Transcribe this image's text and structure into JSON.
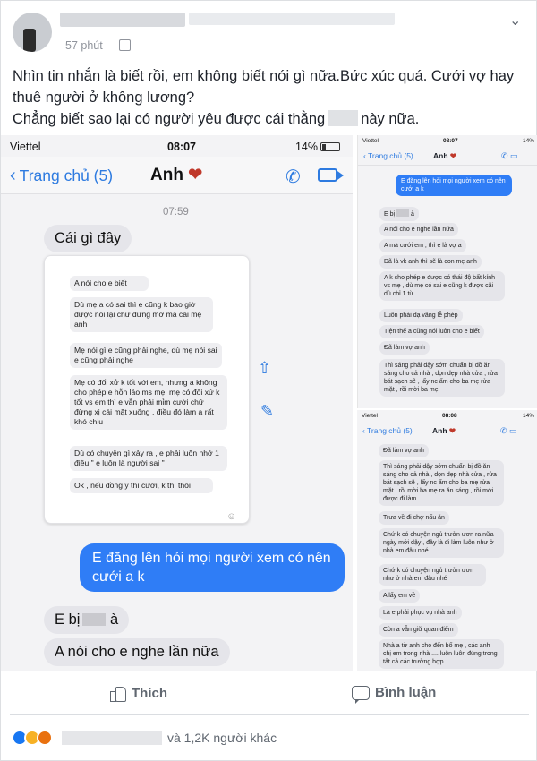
{
  "post": {
    "time": "57 phút",
    "caption_line1": "Nhìn tin nhắn là biết rồi, em không biết nói gì nữa.Bức xúc quá. Cưới vợ hay thuê người ở không lương?",
    "caption_line2a": "Chẳng biết sao lại có người yêu được cái thằng",
    "caption_line2b": "này nữa.",
    "more_icon": "chevron-down-icon"
  },
  "screenshot_main": {
    "carrier": "Viettel",
    "clock": "08:07",
    "battery": "14%",
    "back_label": "Trang chủ (5)",
    "contact": "Anh",
    "timestamp": "07:59",
    "msg1": "Cái gì đây",
    "card_msgs": [
      "A nói cho e biết",
      "Dù mẹ a có sai thì e cũng k bao giờ được nói lại chứ đừng mơ mà cãi mẹ anh",
      "Mẹ nói gì e cũng phải nghe, dù mẹ nói sai e cũng phải nghe",
      "Mẹ có đối xử k tốt với em, nhưng a không cho phép e hỗn láo ms mẹ, mẹ có đối xử k tốt vs em thì e vẫn phải mỉm cười chứ đừng xị cái mặt xuống , điều đó làm a rất khó chịu",
      "Dù có chuyện gì xảy ra , e phải luôn nhớ 1 điều \" e luôn là người sai \"",
      "Ok , nếu đồng ý thì cưới, k thì thôi"
    ],
    "msg_me": "E đăng lên hỏi mọi người xem có nên cưới a k",
    "msg2": "E bị",
    "msg2b": "à",
    "msg3": "A nói cho e nghe lần nữa"
  },
  "screenshot_right_top": {
    "carrier": "Viettel",
    "clock": "08:07",
    "battery": "14%",
    "back_label": "Trang chủ (5)",
    "contact": "Anh",
    "msg_me": "E đăng lên hỏi mọi người xem có nên cưới a k",
    "msgs": [
      "E bị",
      "A nói cho e nghe lần nữa",
      "A mà cưới em , thì e là vợ a",
      "Đã là vk anh thì sẽ là con mẹ anh",
      "A k cho phép e được có thái độ bất kính vs mẹ , dù mẹ có sai e cũng k được cãi dù chỉ 1 từ",
      "Luôn phải dạ vâng lễ phép",
      "Tiện thể a cũng nói luôn cho e biết",
      "Đã làm vợ anh",
      "Thì sáng phải dậy sớm chuẩn bị đồ ăn sáng cho cả nhà , dọn dẹp nhà cửa , rửa bát sạch sẽ , lấy nc ấm cho ba mẹ rửa mặt , rồi mời ba mẹ"
    ]
  },
  "screenshot_right_bottom": {
    "carrier": "Viettel",
    "clock": "08:08",
    "battery": "14%",
    "back_label": "Trang chủ (5)",
    "contact": "Anh",
    "msgs": [
      "Đã làm vợ anh",
      "Thì sáng phải dậy sớm chuẩn bị đồ ăn sáng cho cả nhà , dọn dẹp nhà cửa , rửa bát sạch sẽ , lấy nc ấm cho ba mẹ rửa mặt , rồi mời ba mẹ ra ăn sáng , rồi mới được đi làm",
      "Trưa về đi chợ nấu ăn",
      "Chứ k có chuyện ngủ trưởn ươn ra nữa ngày mới dậy , đây là đi làm luôn như ở nhà em đâu nhé",
      "Chứ k có chuyện ngủ trưởn ươn như ở nhà em đâu nhé",
      "A lấy em về",
      "Là e phải phục vụ nhà anh",
      "Còn a vẫn giữ quan điểm",
      "Nhà a từ anh cho đến bố mẹ , các anh chị em trong nhà .... luôn luôn đúng trong tất cả các trường hợp"
    ]
  },
  "actions": {
    "like_label": "Thích",
    "comment_label": "Bình luận"
  },
  "reactions": {
    "others_text": "và 1,2K người khác"
  },
  "colors": {
    "ios_blue": "#2f7df6",
    "fb_gray": "#606770",
    "like_blue": "#1877f2"
  }
}
